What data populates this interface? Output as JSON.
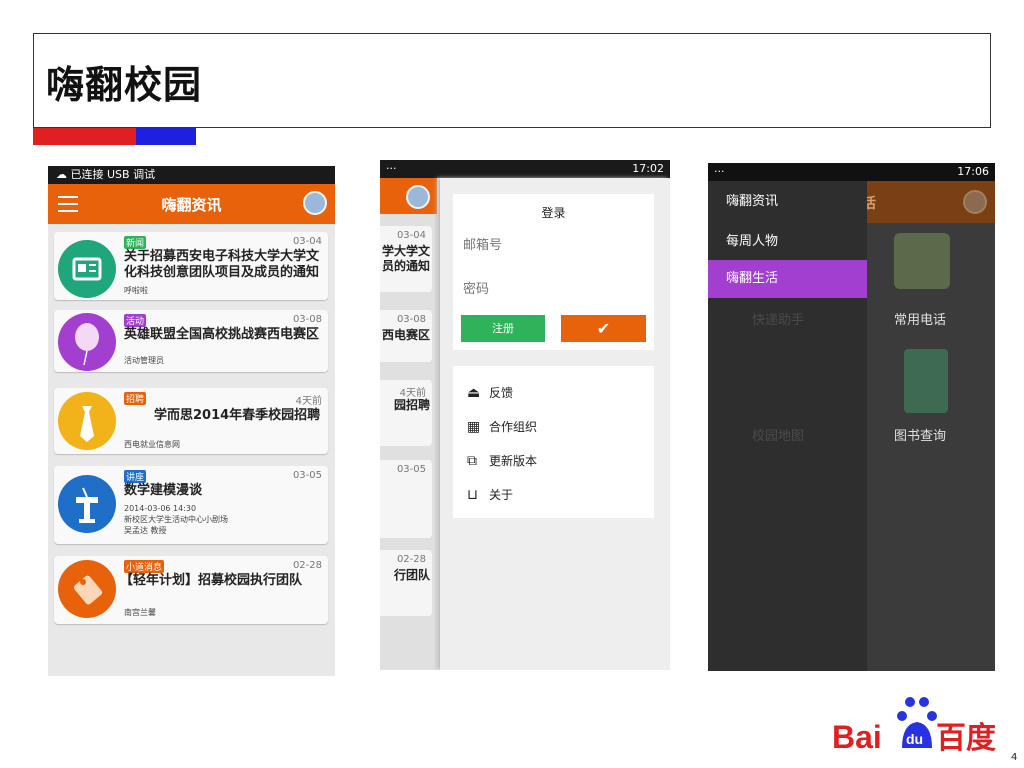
{
  "slide": {
    "title": "嗨翻校园",
    "page_number": "4"
  },
  "colors": {
    "orange": "#e8620c",
    "green": "#2fb35a",
    "purple": "#a23fd0",
    "red": "#e02020",
    "blue": "#1f1fe0"
  },
  "phone1": {
    "status": "已连接 USB 调试",
    "app_title": "嗨翻资讯",
    "cards": [
      {
        "tag": "新闻",
        "date": "03-04",
        "title": "关于招募西安电子科技大学大学文化科技创意团队项目及成员的通知",
        "meta": [
          "呼啦啦"
        ]
      },
      {
        "tag": "活动",
        "date": "03-08",
        "title": "英雄联盟全国高校挑战赛西电赛区",
        "meta": [
          "活动管理员"
        ]
      },
      {
        "tag": "招聘",
        "date": "4天前",
        "title": "学而思2014年春季校园招聘",
        "meta": [
          "西电就业信息网"
        ]
      },
      {
        "tag": "讲座",
        "date": "03-05",
        "title": "数学建模漫谈",
        "meta": [
          "2014-03-06 14:30",
          "新校区大学生活动中心小剧场",
          "吴孟达 教授"
        ]
      },
      {
        "tag": "小道消息",
        "date": "02-28",
        "title": "【轻年计划】招募校园执行团队",
        "meta": [
          "南宫兰馨"
        ]
      }
    ]
  },
  "phone2": {
    "status_left": "···",
    "status_time": "17:02",
    "peek_cards": [
      {
        "date": "03-04",
        "text": "学大学文\n员的通知"
      },
      {
        "date": "03-08",
        "text": "西电赛区"
      },
      {
        "date": "4天前",
        "text": "园招聘"
      },
      {
        "date": "03-05",
        "text": ""
      },
      {
        "date": "02-28",
        "text": "行团队"
      }
    ],
    "login": {
      "title": "登录",
      "email_placeholder": "邮箱号",
      "password_placeholder": "密码",
      "register": "注册",
      "confirm": "✔"
    },
    "menu": [
      {
        "icon": "feedback-icon",
        "label": "反馈"
      },
      {
        "icon": "grid-icon",
        "label": "合作组织"
      },
      {
        "icon": "update-icon",
        "label": "更新版本"
      },
      {
        "icon": "book-icon",
        "label": "关于"
      }
    ]
  },
  "phone3": {
    "status_left": "···",
    "status_time": "17:06",
    "app_title": "嗨翻生活",
    "nav": [
      "嗨翻资讯",
      "每周人物",
      "嗨翻生活"
    ],
    "grid": [
      "快递助手",
      "常用电话",
      "校园地图",
      "图书查询"
    ]
  },
  "logo": {
    "text": "Bai",
    "du": "du",
    "cn": "百度"
  }
}
